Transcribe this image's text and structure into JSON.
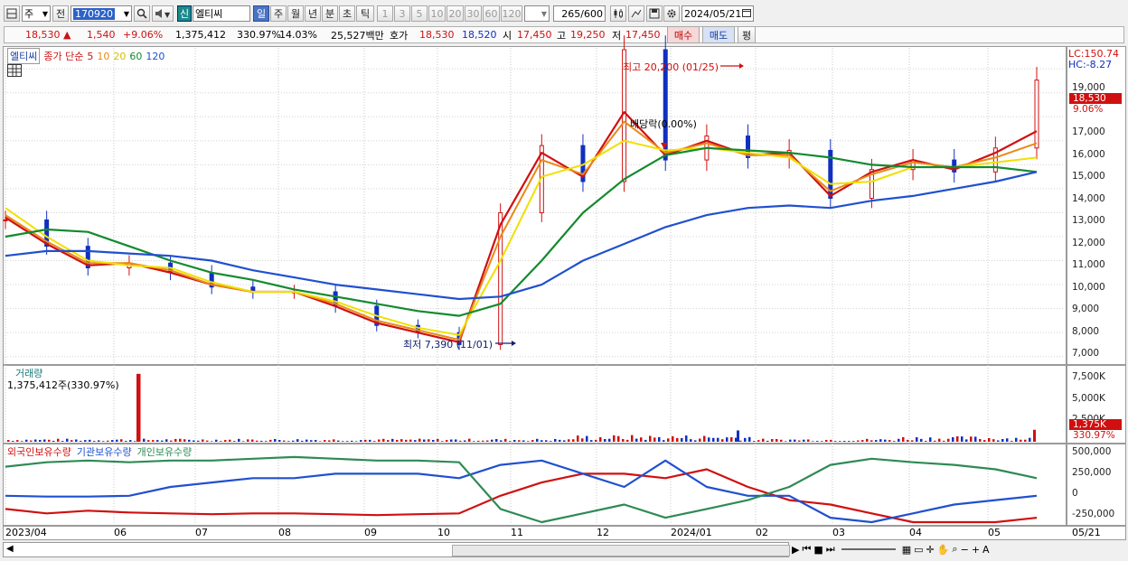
{
  "toolbar": {
    "market": "주",
    "prev_label": "전",
    "stock_code": "170920",
    "badge_new": "신",
    "stock_name": "엘티씨",
    "periods": [
      "일",
      "주",
      "월",
      "년",
      "분",
      "초",
      "틱"
    ],
    "selected_period": "일",
    "intervals": [
      "1",
      "3",
      "5",
      "10",
      "20",
      "30",
      "60",
      "120"
    ],
    "count_value": "265",
    "count_total": "/600",
    "date": "2024/05/21"
  },
  "quote": {
    "price": "18,530",
    "arrow": "▲",
    "change": "1,540",
    "change_pct": "+9.06%",
    "volume": "1,375,412",
    "volume_ratio": "330.97%",
    "turnover": "14.03%",
    "amount": "25,527백만",
    "hoga_label": "호가",
    "ask": "18,530",
    "bid": "18,520",
    "open_label": "시",
    "open": "17,450",
    "high_label": "고",
    "high": "19,250",
    "low_label": "저",
    "low": "17,450",
    "buy_button": "매수",
    "sell_button": "매도",
    "eval_button": "평"
  },
  "price_panel": {
    "name": "엘티씨",
    "legend": [
      "종가 단순",
      "5",
      "10",
      "20",
      "60",
      "120"
    ],
    "legend_colors": [
      "#d01010",
      "#d01010",
      "#e88a1a",
      "#f0e000",
      "#138a2e",
      "#2050d0"
    ],
    "lc": "LC:150.74",
    "hc": "HC:-8.27",
    "last_price": "18,530",
    "last_pct": "9.06%",
    "high_note": "최고 20,200 (01/25)",
    "low_note": "최저 7,390 (11/01)",
    "dividend_note": "배당락(0.00%)",
    "y_labels": [
      "19,000",
      "18,000",
      "17,000",
      "16,000",
      "15,000",
      "14,000",
      "13,000",
      "12,000",
      "11,000",
      "10,000",
      "9,000",
      "8,000",
      "7,000"
    ]
  },
  "volume_panel": {
    "title": "거래량",
    "value": "1,375,412주(330.97%)",
    "y_labels": [
      "7,500K",
      "5,000K",
      "2,500K"
    ],
    "last": "1,375K",
    "last_pct": "330.97%"
  },
  "holding_panel": {
    "legend": [
      "외국인보유수량",
      "기관보유수량",
      "개인보유수량"
    ],
    "legend_colors": [
      "#d01010",
      "#2050d0",
      "#2e8a55"
    ],
    "y_labels": [
      "500,000",
      "250,000",
      "0",
      "-250,000"
    ]
  },
  "x_axis": [
    "2023/04",
    "06",
    "07",
    "08",
    "09",
    "10",
    "11",
    "12",
    "2024/01",
    "02",
    "03",
    "04",
    "05",
    "05/21"
  ],
  "chart_data": {
    "type": "candlestick",
    "title": "엘티씨",
    "x": [
      "2023/04",
      "06",
      "07",
      "08",
      "09",
      "10",
      "11",
      "12",
      "2024/01",
      "02",
      "03",
      "04",
      "05",
      "05/21"
    ],
    "y_range": [
      6800,
      19800
    ],
    "series": [
      {
        "name": "종가 단순",
        "values": [
          12700,
          11600,
          10700,
          10900,
          10500,
          9900,
          9700,
          9700,
          9100,
          8300,
          8000,
          7500,
          13000,
          15800,
          14300,
          19800,
          15200,
          16200,
          15300,
          15600,
          13600,
          14800,
          15200,
          14700,
          15700,
          18530
        ]
      },
      {
        "name": "5",
        "values": [
          12800,
          11700,
          10800,
          10900,
          10500,
          10000,
          9700,
          9700,
          9100,
          8400,
          8000,
          7600,
          12500,
          15500,
          14500,
          17200,
          15400,
          16000,
          15400,
          15500,
          13700,
          14700,
          15200,
          14800,
          15500,
          16400
        ]
      },
      {
        "name": "10",
        "values": [
          12900,
          11800,
          10900,
          10900,
          10600,
          10000,
          9700,
          9700,
          9200,
          8500,
          8100,
          7700,
          12000,
          15200,
          14600,
          16800,
          15500,
          15900,
          15400,
          15400,
          13900,
          14600,
          15100,
          14900,
          15300,
          15900
        ]
      },
      {
        "name": "20",
        "values": [
          13200,
          12000,
          11000,
          10800,
          10700,
          10100,
          9700,
          9700,
          9300,
          8700,
          8200,
          7900,
          11000,
          14500,
          15000,
          16000,
          15600,
          15700,
          15500,
          15300,
          14200,
          14300,
          14900,
          14900,
          15100,
          15300
        ]
      },
      {
        "name": "60",
        "values": [
          12000,
          12300,
          12200,
          11600,
          11000,
          10500,
          10200,
          9800,
          9500,
          9200,
          8900,
          8700,
          9200,
          11000,
          13000,
          14400,
          15400,
          15700,
          15600,
          15500,
          15300,
          15000,
          14900,
          14900,
          14900,
          14700
        ]
      },
      {
        "name": "120",
        "values": [
          11200,
          11400,
          11400,
          11300,
          11200,
          11000,
          10600,
          10300,
          10000,
          9800,
          9600,
          9400,
          9500,
          10000,
          11000,
          11700,
          12400,
          12900,
          13200,
          13300,
          13200,
          13500,
          13700,
          14000,
          14300,
          14700
        ]
      }
    ],
    "annotations": [
      {
        "text": "최고 20,200 (01/25)",
        "value": 20200,
        "date": "01/25"
      },
      {
        "text": "최저 7,390 (11/01)",
        "value": 7390,
        "date": "11/01"
      },
      {
        "text": "배당락(0.00%)"
      }
    ],
    "volume": {
      "name": "거래량",
      "y_labels": [
        "7,500K",
        "5,000K",
        "2,500K"
      ],
      "last": 1375412
    },
    "holdings": [
      {
        "name": "외국인보유수량",
        "values": [
          -150000,
          -200000,
          -170000,
          -190000,
          -200000,
          -210000,
          -200000,
          -200000,
          -210000,
          -220000,
          -210000,
          -200000,
          0,
          150000,
          250000,
          250000,
          200000,
          300000,
          100000,
          -50000,
          -100000,
          -200000,
          -300000,
          -300000,
          -300000,
          -250000
        ]
      },
      {
        "name": "기관보유수량",
        "values": [
          0,
          -10000,
          -10000,
          0,
          100000,
          150000,
          200000,
          200000,
          250000,
          250000,
          250000,
          200000,
          350000,
          400000,
          250000,
          100000,
          400000,
          100000,
          0,
          0,
          -250000,
          -300000,
          -200000,
          -100000,
          -50000,
          0
        ]
      },
      {
        "name": "개인보유수량",
        "values": [
          330000,
          380000,
          400000,
          380000,
          400000,
          400000,
          420000,
          440000,
          420000,
          400000,
          400000,
          380000,
          -150000,
          -300000,
          -200000,
          -100000,
          -250000,
          -150000,
          -50000,
          100000,
          350000,
          420000,
          380000,
          350000,
          300000,
          200000
        ]
      }
    ]
  }
}
